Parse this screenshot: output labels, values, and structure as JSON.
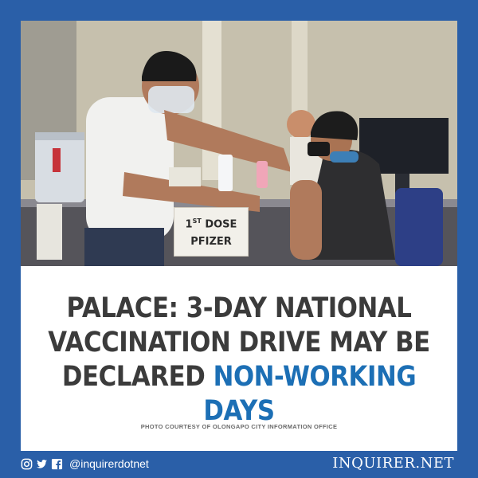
{
  "photo": {
    "sign_text_1": "1",
    "sign_text_1_suffix": "ST",
    "sign_text_1_word": "DOSE",
    "sign_text_2": "PFIZER"
  },
  "headline": {
    "line1": "PALACE: 3-DAY NATIONAL",
    "line2": "VACCINATION DRIVE MAY BE",
    "line3_plain": "DECLARED ",
    "line3_highlight": "NON-WORKING DAYS"
  },
  "credit": "PHOTO COURTESY OF OLONGAPO CITY INFORMATION OFFICE",
  "footer": {
    "handle": "@inquirerdotnet",
    "brand": "INQUIRER.NET",
    "icons": [
      "instagram-icon",
      "twitter-icon",
      "facebook-icon"
    ]
  },
  "colors": {
    "frame": "#2a5fa8",
    "headline": "#3b3b3b",
    "highlight": "#1c6fb5"
  }
}
